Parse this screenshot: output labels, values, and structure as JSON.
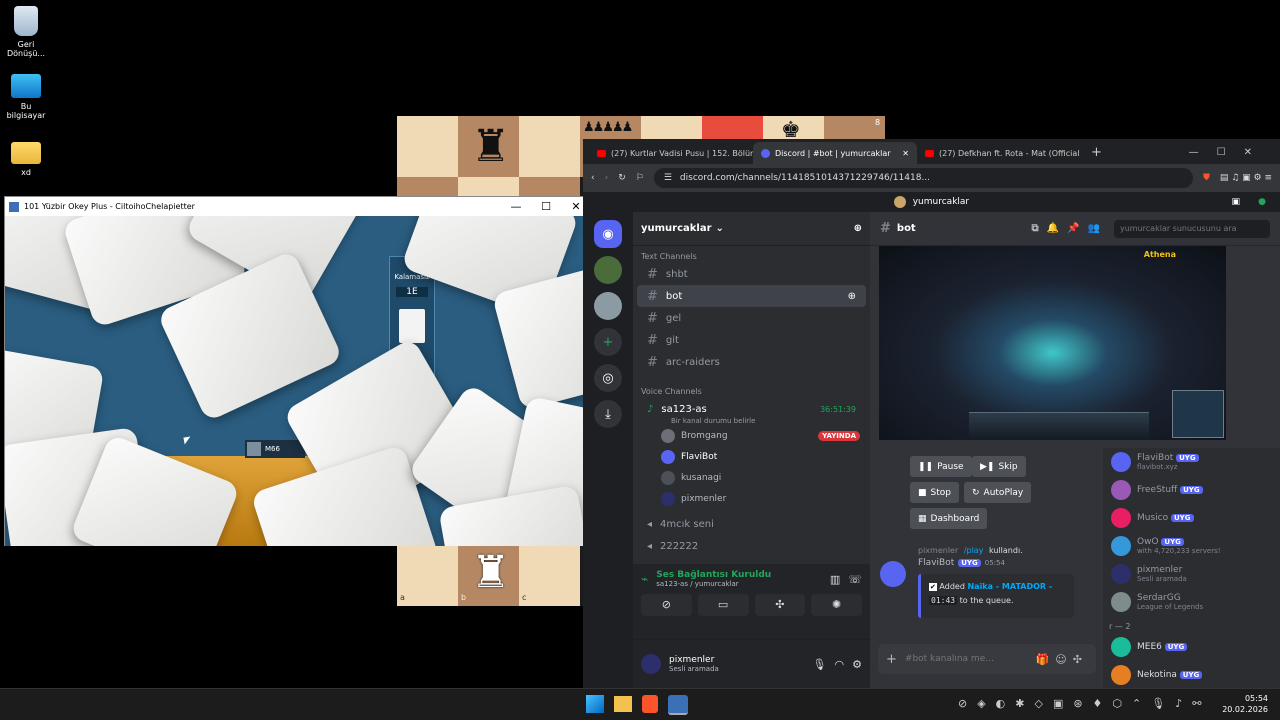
{
  "desktop": {
    "icons": [
      {
        "label": "Geri Dönüşü...",
        "icon": "recycle-bin-icon"
      },
      {
        "label": "Bu bilgisayar",
        "icon": "computer-icon"
      },
      {
        "label": "xd",
        "icon": "folder-icon"
      }
    ]
  },
  "chess": {
    "coords": [
      "a",
      "b",
      "c"
    ],
    "rank_label": "8"
  },
  "okey": {
    "title": "101 Yüzbir Okey Plus - CiltoihoChelapietter",
    "minimize": "—",
    "maximize": "☐",
    "close": "✕",
    "panel_label": "Kalamasız",
    "counter": "1E",
    "player_tag": "M66"
  },
  "browser": {
    "tabs": [
      {
        "label": "(27) Kurtlar Vadisi Pusu | 152. Bölüm",
        "icon": "youtube-icon",
        "active": false
      },
      {
        "label": "Discord | #bot | yumurcaklar",
        "icon": "discord-icon",
        "active": true
      },
      {
        "label": "(27) Defkhan ft. Rota - Mat (Official A",
        "icon": "youtube-icon",
        "active": false
      }
    ],
    "tab_close": "✕",
    "new_tab": "+",
    "url": "discord.com/channels/1141851014371229746/11418..."
  },
  "discord": {
    "top_title": "yumurcaklar",
    "server_name": "yumurcaklar",
    "text_category": "Text Channels",
    "text_channels": [
      "shbt",
      "bot",
      "gel",
      "git",
      "arc-raiders"
    ],
    "selected_channel": "bot",
    "voice_category": "Voice Channels",
    "voice_channel": {
      "name": "sa123-as",
      "timer": "36:51:39",
      "status": "Bir kanal durumu belirle"
    },
    "voice_users": [
      {
        "name": "Bromgang",
        "badge": "YAYINDA"
      },
      {
        "name": "FlaviBot",
        "badge": ""
      },
      {
        "name": "kusanagi",
        "badge": ""
      },
      {
        "name": "pixmenler",
        "badge": ""
      }
    ],
    "more_voice": [
      "4mcık seni",
      "222222"
    ],
    "connection": {
      "status": "Ses Bağlantısı Kuruldu",
      "detail": "sa123-as / yumurcaklar"
    },
    "user": {
      "name": "pixmenler",
      "status": "Sesli aramada"
    },
    "channel_header": "bot",
    "search_placeholder": "yumurcaklar sunucusunu ara",
    "stream_overlay": "Athena",
    "controls": {
      "pause": "Pause",
      "skip": "Skip",
      "stop": "Stop",
      "autoplay": "AutoPlay",
      "dashboard": "Dashboard"
    },
    "message": {
      "reply_user": "pixmenler",
      "reply_cmd": "/play",
      "reply_suffix": "kullandı.",
      "author": "FlaviBot",
      "author_badge": "UYG",
      "time": "05:54",
      "added": "Added",
      "song": "Naïka - MATADOR -",
      "duration": "01:43",
      "queue_text": "to the queue."
    },
    "message_placeholder": "#bot kanalına me...",
    "members": [
      {
        "name": "FlaviBot",
        "badge": "UYG",
        "sub": "flavibot.xyz",
        "color": "#5865f2"
      },
      {
        "name": "FreeStuff",
        "badge": "UYG",
        "sub": "",
        "color": "#9b59b6"
      },
      {
        "name": "Musico",
        "badge": "UYG",
        "sub": "",
        "color": "#e91e63"
      },
      {
        "name": "OwO",
        "badge": "UYG",
        "sub": "with 4,720,233 servers!",
        "color": "#3498db"
      },
      {
        "name": "pixmenler",
        "badge": "",
        "sub": "Sesli aramada",
        "color": "#2c2f6b"
      },
      {
        "name": "SerdarGG",
        "badge": "",
        "sub": "League of Legends",
        "color": "#7f8c8d"
      }
    ],
    "member_category": "r — 2",
    "offline_members": [
      {
        "name": "MEE6",
        "badge": "UYG",
        "color": "#1abc9c"
      },
      {
        "name": "Nekotina",
        "badge": "UYG",
        "color": "#e67e22"
      }
    ]
  },
  "taskbar": {
    "time": "05:54",
    "date": "20.02.2026"
  }
}
